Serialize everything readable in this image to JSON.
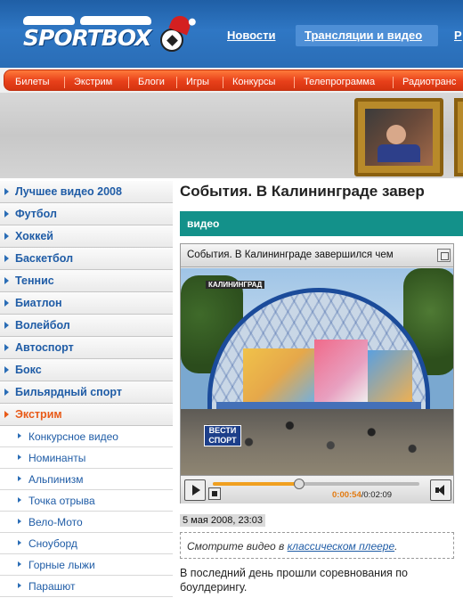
{
  "header": {
    "logo_text": "SPORTBOX",
    "nav": [
      "Новости",
      "Трансляции и видео",
      "Р"
    ]
  },
  "orange_nav": [
    "Билеты",
    "Экстрим",
    "Блоги",
    "Игры",
    "Конкурсы",
    "Телепрограмма",
    "Радиотранс"
  ],
  "sidebar": {
    "main_items": [
      "Лучшее видео 2008",
      "Футбол",
      "Хоккей",
      "Баскетбол",
      "Теннис",
      "Биатлон",
      "Волейбол",
      "Автоспорт",
      "Бокс",
      "Бильярдный спорт"
    ],
    "active_item": "Экстрим",
    "sub_items": [
      "Конкурсное видео",
      "Номинанты",
      "Альпинизм",
      "Точка отрыва",
      "Вело-Мото",
      "Сноуборд",
      "Горные лыжи",
      "Парашют"
    ]
  },
  "main": {
    "title": "События. В Калининграде завер",
    "section_label": "видео",
    "player": {
      "title": "События.  В Калининграде завершился чем",
      "time_current": "0:00:54",
      "time_total": "/0:02:09",
      "progress": 0.418,
      "overlay_logo_line1": "ВЕСТИ",
      "overlay_logo_line2": "СПОРТ",
      "overlay_banner": "КАЛИНИНГРАД"
    },
    "date": "5 мая 2008, 23:03",
    "watch_prefix": "Смотрите видео в ",
    "watch_link": "классическом плеере",
    "watch_suffix": ".",
    "body": "В последний день прошли соревнования по боулдерингу."
  }
}
